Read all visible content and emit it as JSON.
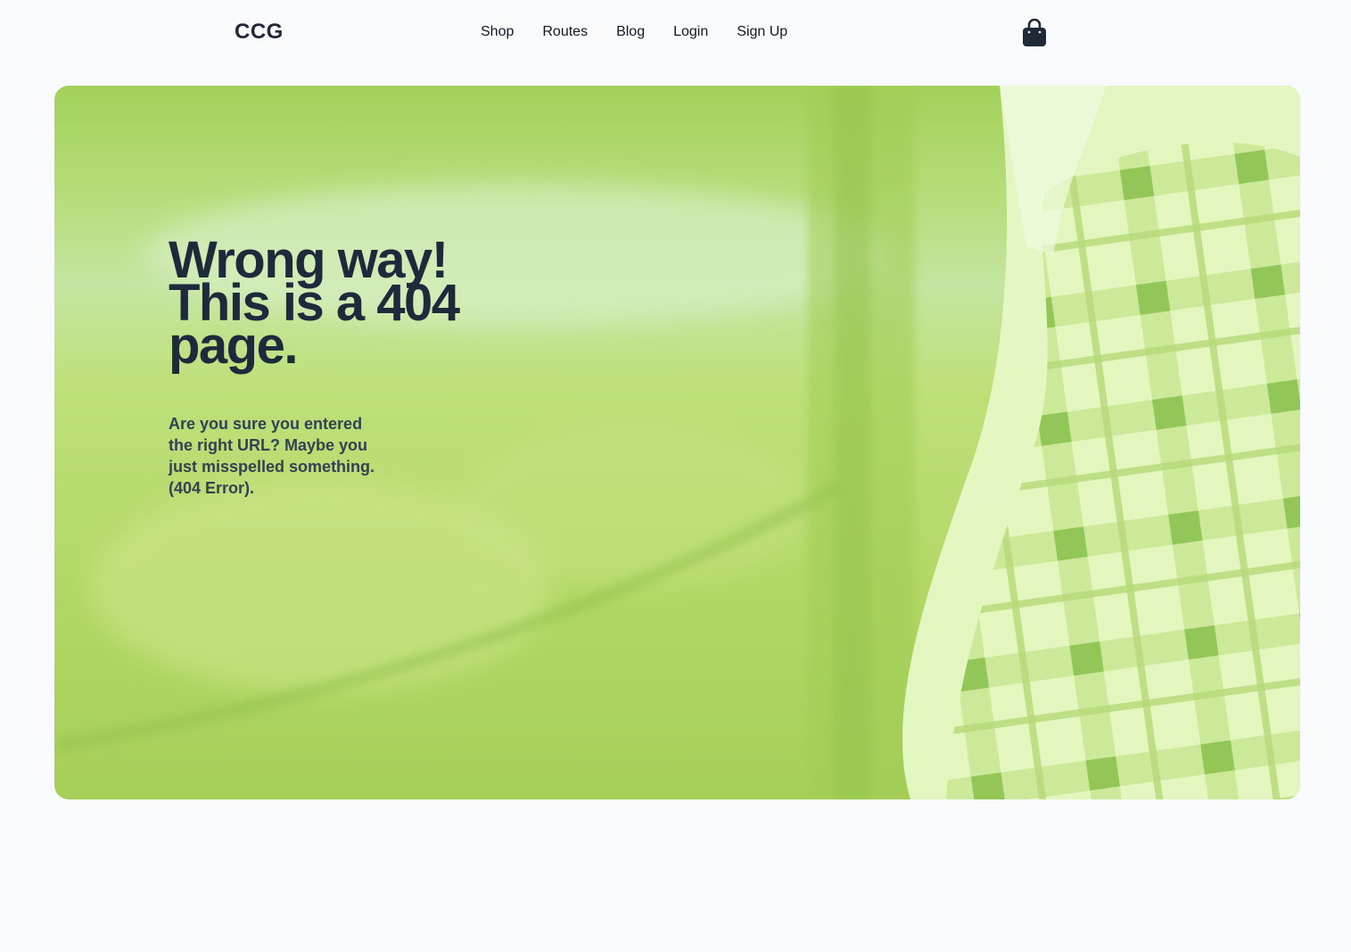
{
  "brand": {
    "logo": "CCG"
  },
  "nav": {
    "links": [
      {
        "label": "Shop"
      },
      {
        "label": "Routes"
      },
      {
        "label": "Blog"
      },
      {
        "label": "Login"
      },
      {
        "label": "Sign Up"
      }
    ],
    "cart_icon": "shopping-bag-icon"
  },
  "hero": {
    "headline": "Wrong way! This is a 404 page.",
    "message": "Are you sure you entered the right URL? Maybe you just misspelled something. (404 Error).",
    "background_image": "blurred green field with person in plaid shirt",
    "accent_color": "#a3d15b"
  },
  "colors": {
    "page_bg": "#f8fafc",
    "text_dark": "#1e293b",
    "text_muted": "#334155"
  }
}
